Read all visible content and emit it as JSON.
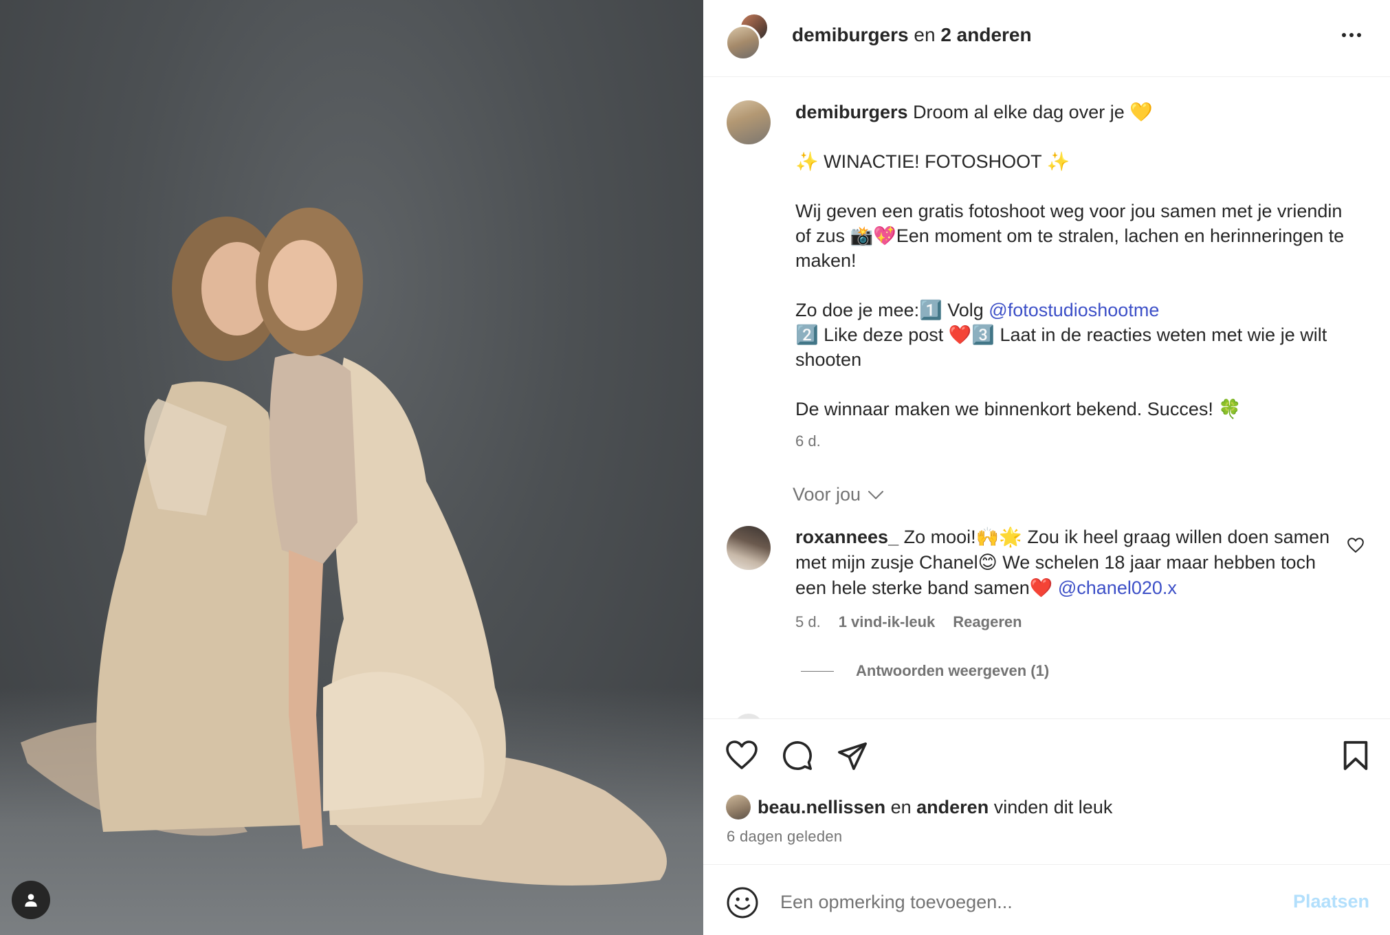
{
  "header": {
    "username": "demiburgers",
    "joiner": "en",
    "others": "2 anderen"
  },
  "caption": {
    "username": "demiburgers",
    "line1": "Droom al elke dag over je 💛",
    "line2": "✨ WINACTIE! FOTOSHOOT ✨",
    "line3": "Wij geven een gratis fotoshoot weg voor jou samen met je vriendin of zus 📸💖Een moment om te stralen, lachen en herinneringen te maken!",
    "line4_prefix": "Zo doe je mee:1️⃣ Volg ",
    "line4_mention": "@fotostudioshootme",
    "line5": "2️⃣ Like deze post ❤️3️⃣ Laat in de reacties weten met wie je wilt shooten",
    "line6": "De winnaar maken we binnenkort bekend. Succes! 🍀",
    "time": "6 d."
  },
  "filter": {
    "label": "Voor jou"
  },
  "comment": {
    "username": "roxannees_",
    "text": "Zo mooi!🙌🌟 Zou ik heel graag willen doen samen met mijn zusje Chanel😊 We schelen 18 jaar maar hebben toch een hele sterke band samen❤️ ",
    "mention": "@chanel020.x",
    "time": "5 d.",
    "likes": "1 vind-ik-leuk",
    "reply": "Reageren",
    "view_replies": "Antwoorden weergeven (1)"
  },
  "likes": {
    "user": "beau.nellissen",
    "joiner": "en",
    "others": "anderen",
    "suffix": "vinden dit leuk"
  },
  "post_date": "6 dagen geleden",
  "composer": {
    "placeholder": "Een opmerking toevoegen...",
    "post_label": "Plaatsen"
  },
  "colors": {
    "link": "#3c4fc7",
    "secondary_text": "#737373",
    "post_button_disabled": "#b2dffc"
  }
}
